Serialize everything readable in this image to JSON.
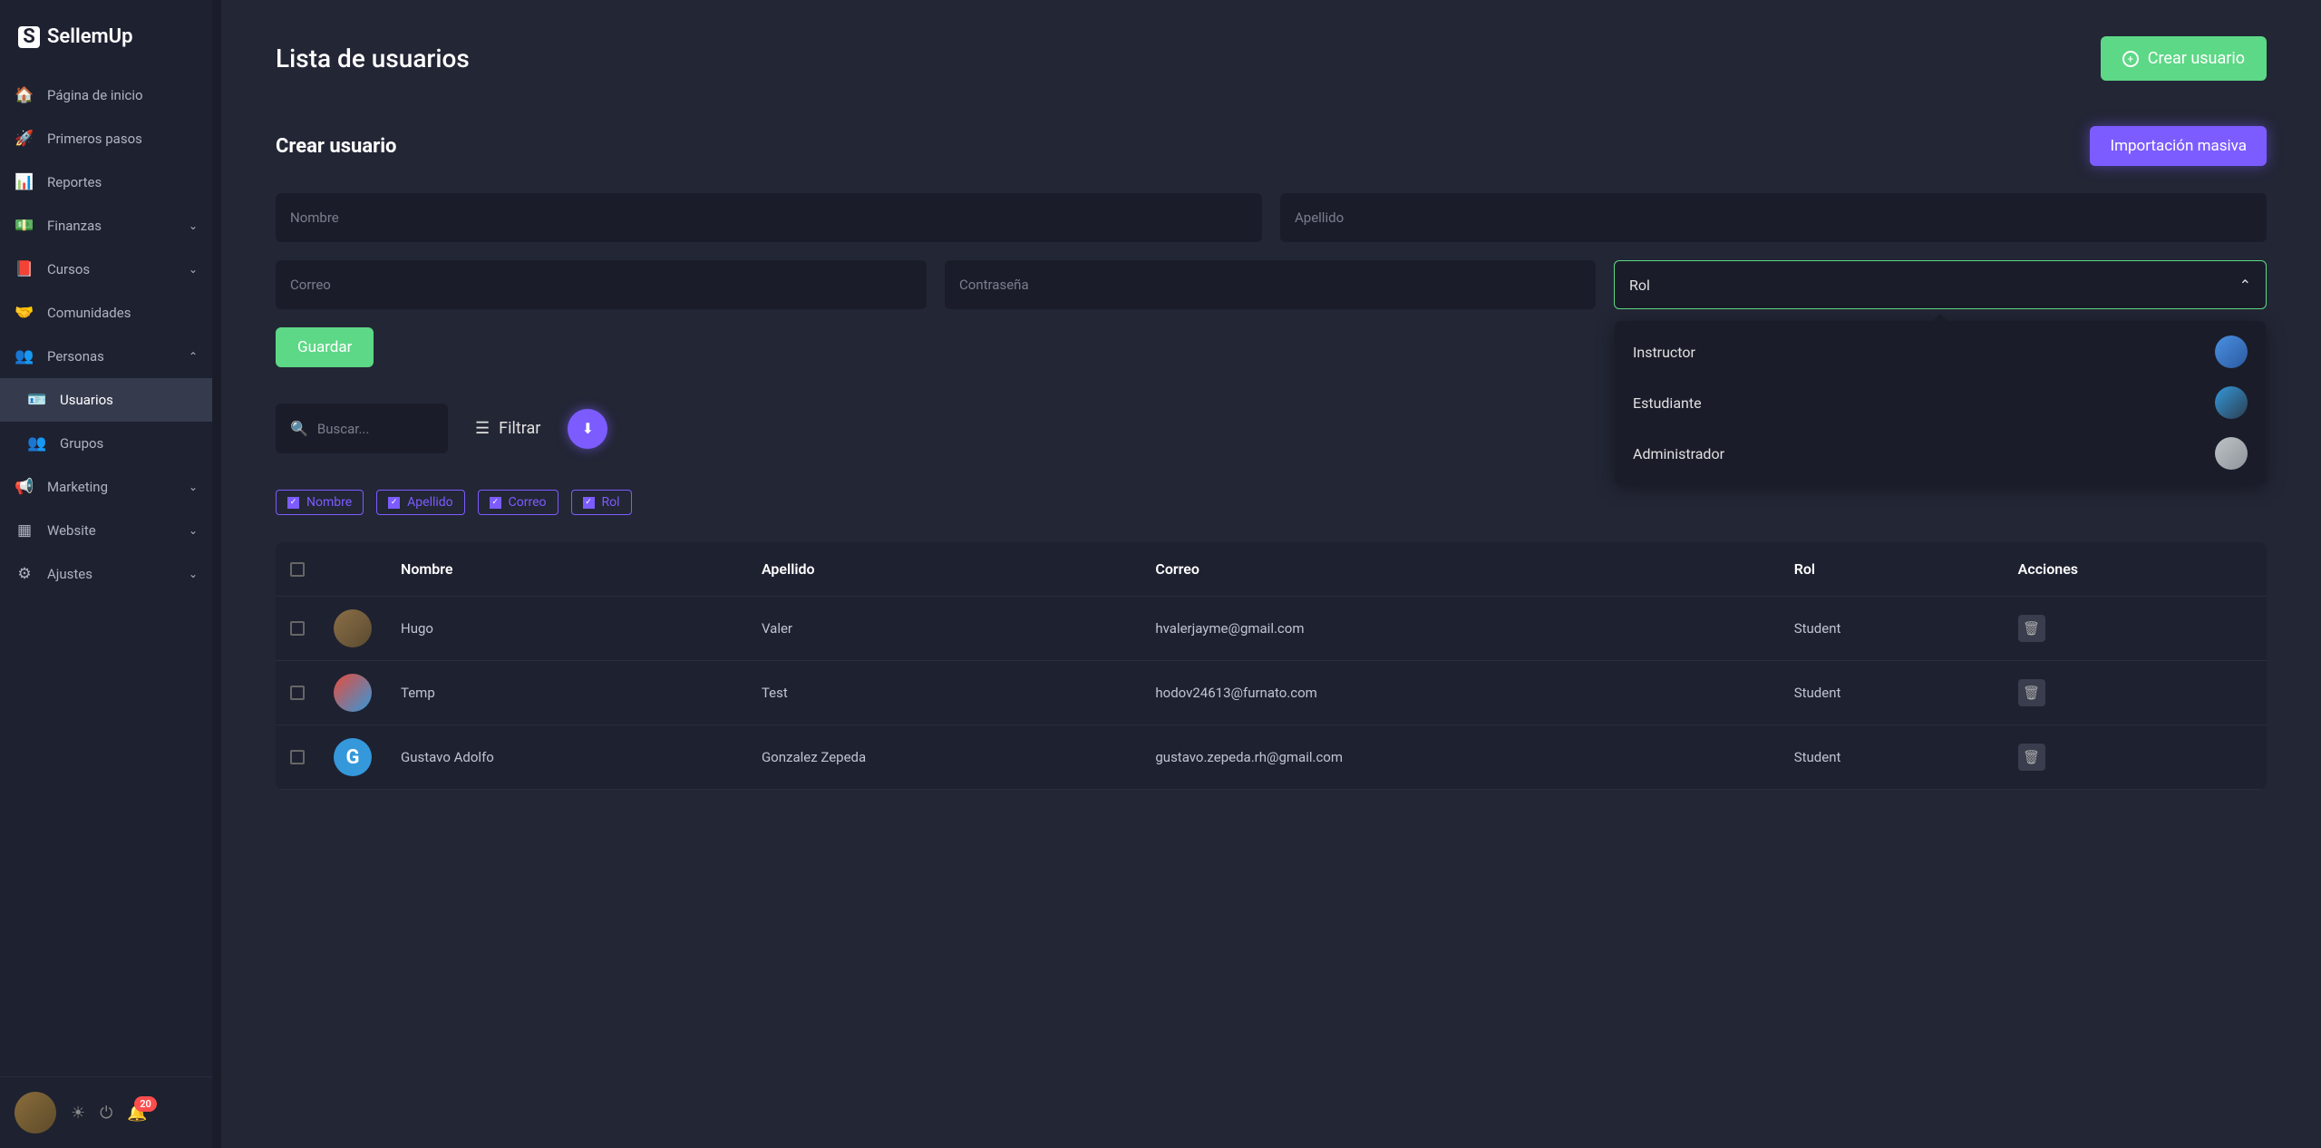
{
  "brand": "SellemUp",
  "sidebar": {
    "items": [
      {
        "icon": "home",
        "label": "Página de inicio"
      },
      {
        "icon": "rocket",
        "label": "Primeros pasos"
      },
      {
        "icon": "chart",
        "label": "Reportes"
      },
      {
        "icon": "cash",
        "label": "Finanzas",
        "expandable": true
      },
      {
        "icon": "book",
        "label": "Cursos",
        "expandable": true
      },
      {
        "icon": "hands",
        "label": "Comunidades"
      },
      {
        "icon": "users",
        "label": "Personas",
        "expandable": true,
        "expanded": true
      },
      {
        "icon": "bullhorn",
        "label": "Marketing",
        "expandable": true
      },
      {
        "icon": "grid",
        "label": "Website",
        "expandable": true
      },
      {
        "icon": "gear",
        "label": "Ajustes",
        "expandable": true
      }
    ],
    "subitems": [
      {
        "icon": "id",
        "label": "Usuarios",
        "active": true
      },
      {
        "icon": "group",
        "label": "Grupos"
      }
    ]
  },
  "bottombar": {
    "notification_count": "20"
  },
  "page": {
    "title": "Lista de usuarios",
    "create_button": "Crear usuario"
  },
  "create_section": {
    "title": "Crear usuario",
    "import_button": "Importación masiva",
    "nombre_placeholder": "Nombre",
    "apellido_placeholder": "Apellido",
    "correo_placeholder": "Correo",
    "password_placeholder": "Contraseña",
    "rol_label": "Rol",
    "save_button": "Guardar"
  },
  "rol_dropdown": {
    "options": [
      {
        "label": "Instructor"
      },
      {
        "label": "Estudiante"
      },
      {
        "label": "Administrador"
      }
    ]
  },
  "toolbar": {
    "search_placeholder": "Buscar...",
    "filter_label": "Filtrar"
  },
  "chips": [
    {
      "label": "Nombre"
    },
    {
      "label": "Apellido"
    },
    {
      "label": "Correo"
    },
    {
      "label": "Rol"
    }
  ],
  "table": {
    "headers": {
      "nombre": "Nombre",
      "apellido": "Apellido",
      "correo": "Correo",
      "rol": "Rol",
      "acciones": "Acciones"
    },
    "rows": [
      {
        "avatar": "a1",
        "initial": "",
        "nombre": "Hugo",
        "apellido": "Valer",
        "correo": "hvalerjayme@gmail.com",
        "rol": "Student"
      },
      {
        "avatar": "a2",
        "initial": "",
        "nombre": "Temp",
        "apellido": "Test",
        "correo": "hodov24613@furnato.com",
        "rol": "Student"
      },
      {
        "avatar": "a3",
        "initial": "G",
        "nombre": "Gustavo Adolfo",
        "apellido": "Gonzalez Zepeda",
        "correo": "gustavo.zepeda.rh@gmail.com",
        "rol": "Student"
      }
    ]
  }
}
